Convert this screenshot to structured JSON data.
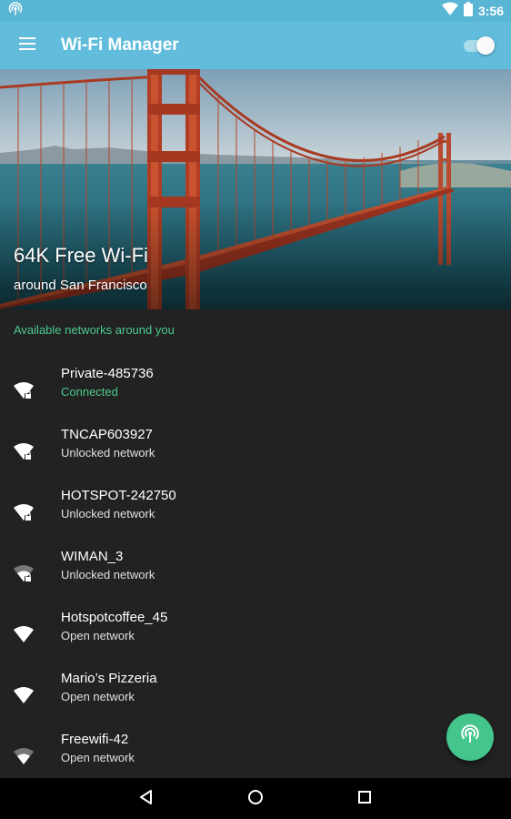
{
  "status_bar": {
    "time": "3:56"
  },
  "app_bar": {
    "title": "Wi-Fi Manager",
    "toggle_on": true
  },
  "hero": {
    "title": "64K Free Wi-Fi",
    "subtitle": "around San Francisco"
  },
  "section_header": "Available networks around you",
  "networks": [
    {
      "name": "Private-485736",
      "status": "Connected",
      "locked": true,
      "strength": "full"
    },
    {
      "name": "TNCAP603927",
      "status": "Unlocked network",
      "locked": true,
      "strength": "full"
    },
    {
      "name": "HOTSPOT-242750",
      "status": "Unlocked network",
      "locked": true,
      "strength": "full"
    },
    {
      "name": "WIMAN_3",
      "status": "Unlocked network",
      "locked": true,
      "strength": "medium"
    },
    {
      "name": "Hotspotcoffee_45",
      "status": "Open network",
      "locked": false,
      "strength": "full"
    },
    {
      "name": "Mario’s Pizzeria",
      "status": "Open network",
      "locked": false,
      "strength": "full"
    },
    {
      "name": "Freewifi-42",
      "status": "Open network",
      "locked": false,
      "strength": "medium"
    }
  ],
  "colors": {
    "accent": "#4cc98d",
    "app_bar": "#62bcdb",
    "status_bar": "#58b5d3",
    "fab": "#43c58b",
    "background": "#222222"
  },
  "icons": {
    "status_left": "wifi-tethering-icon",
    "status_wifi": "wifi-signal-icon",
    "status_battery": "battery-icon",
    "menu": "menu-icon",
    "fab": "wifi-hotspot-icon",
    "nav_back": "back-icon",
    "nav_home": "home-icon",
    "nav_recents": "recents-icon"
  }
}
